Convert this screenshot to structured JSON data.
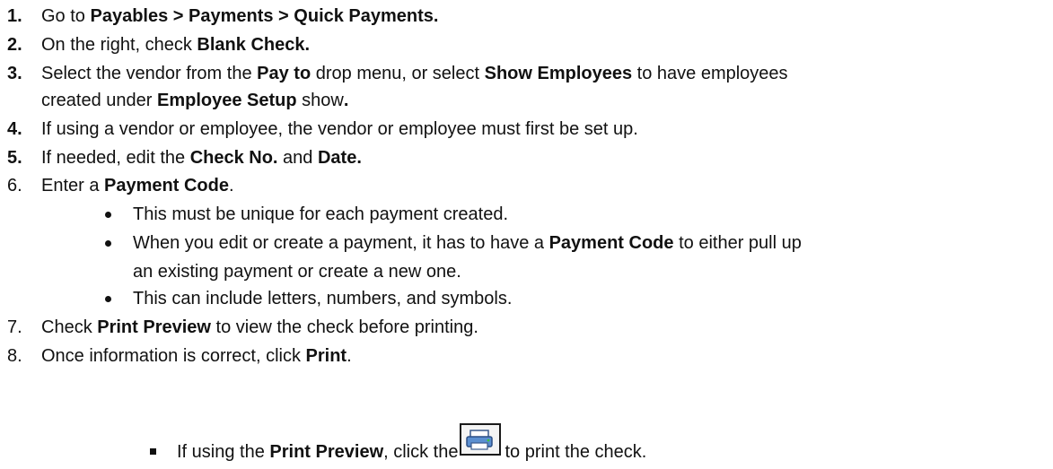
{
  "steps": [
    {
      "num": "1.",
      "parts": [
        {
          "t": "Go to "
        },
        {
          "t": "Payables > Payments > Quick Payments.",
          "b": true
        }
      ]
    },
    {
      "num": "2.",
      "parts": [
        {
          "t": "On the right, check "
        },
        {
          "t": "Blank Check.",
          "b": true
        }
      ]
    },
    {
      "num": "3.",
      "parts": [
        {
          "t": "Select the vendor from the "
        },
        {
          "t": "Pay to",
          "b": true
        },
        {
          "t": " drop menu, or select "
        },
        {
          "t": "Show Employees",
          "b": true
        },
        {
          "t": " to have employees"
        }
      ]
    },
    {
      "cont": true,
      "parts": [
        {
          "t": "created under "
        },
        {
          "t": "Employee Setup",
          "b": true
        },
        {
          "t": " show"
        },
        {
          "t": ".",
          "b": true
        }
      ]
    },
    {
      "num": "4.",
      "parts": [
        {
          "t": "If using a vendor or employee, the vendor or employee must first be set up."
        }
      ]
    },
    {
      "num": "5.",
      "parts": [
        {
          "t": "If needed, edit the "
        },
        {
          "t": "Check No.",
          "b": true
        },
        {
          "t": " and "
        },
        {
          "t": "Date.",
          "b": true
        }
      ]
    },
    {
      "num": "6.",
      "plain": true,
      "parts": [
        {
          "t": "Enter a "
        },
        {
          "t": "Payment Code",
          "b": true
        },
        {
          "t": "."
        }
      ]
    }
  ],
  "bullets": [
    {
      "parts": [
        {
          "t": "This must be unique for each payment created."
        }
      ]
    },
    {
      "parts": [
        {
          "t": "When you edit or create a payment, it has to have a "
        },
        {
          "t": "Payment Code",
          "b": true
        },
        {
          "t": " to either pull up"
        }
      ]
    },
    {
      "cont": true,
      "parts": [
        {
          "t": "an existing payment or create a new one."
        }
      ]
    },
    {
      "parts": [
        {
          "t": "This can include letters, numbers, and symbols."
        }
      ]
    }
  ],
  "steps2": [
    {
      "num": "7.",
      "parts": [
        {
          "t": "Check "
        },
        {
          "t": "Print Preview",
          "b": true
        },
        {
          "t": " to view the check before printing."
        }
      ]
    },
    {
      "num": "8.",
      "parts": [
        {
          "t": "Once information is correct, click "
        },
        {
          "t": "Print",
          "b": true
        },
        {
          "t": "."
        }
      ]
    }
  ],
  "sub_bullet": {
    "before": [
      {
        "t": "If using the "
      },
      {
        "t": "Print Preview",
        "b": true
      },
      {
        "t": ", click the "
      }
    ],
    "after": [
      {
        "t": "to print the check."
      }
    ],
    "icon": "printer-icon"
  }
}
